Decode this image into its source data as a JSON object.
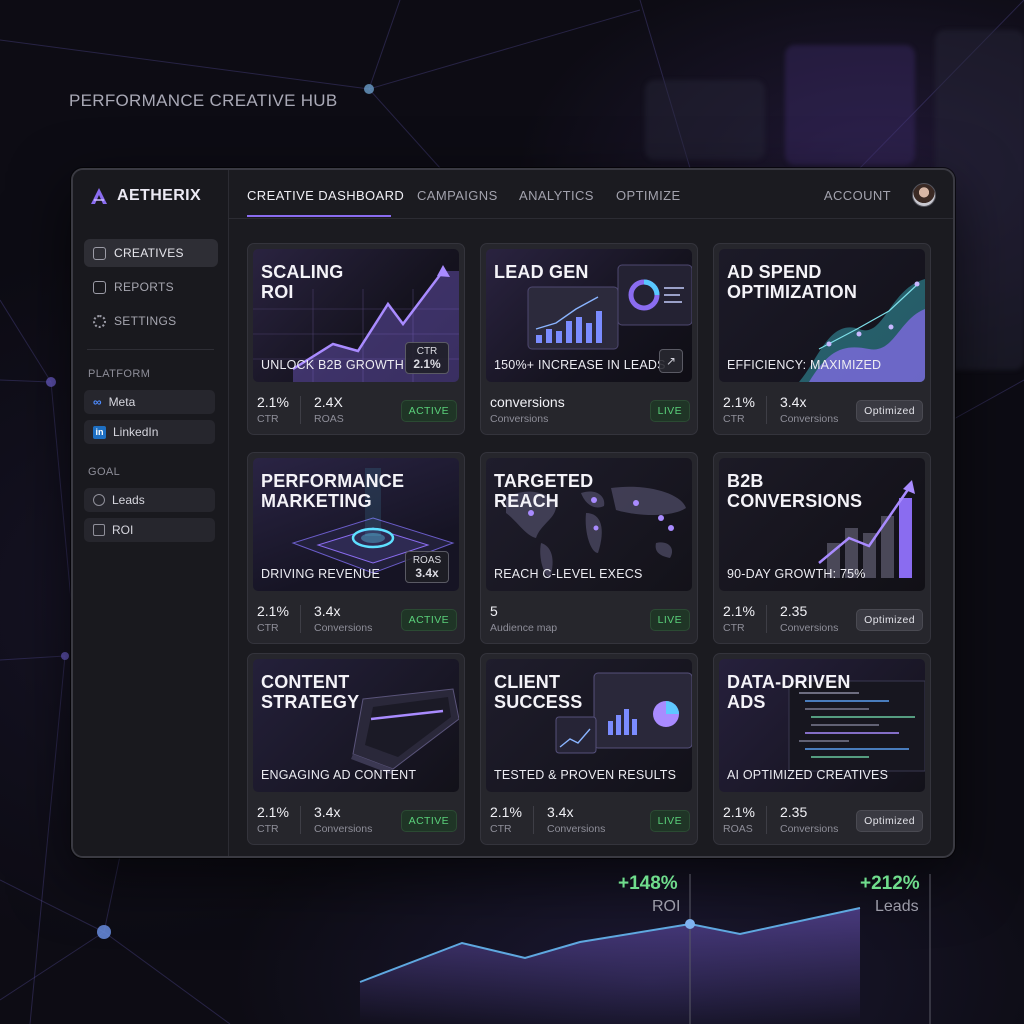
{
  "hub_title": "PERFORMANCE CREATIVE HUB",
  "brand": {
    "name": "AETHERIX",
    "logo_icon": "aetherix-logo-icon"
  },
  "sidebar": {
    "nav": [
      {
        "label": "CREATIVES",
        "icon": "image-icon",
        "active": true
      },
      {
        "label": "REPORTS",
        "icon": "report-icon",
        "active": false
      },
      {
        "label": "SETTINGS",
        "icon": "gear-icon",
        "active": false
      }
    ],
    "platform_heading": "PLATFORM",
    "platforms": [
      {
        "label": "Meta",
        "icon": "meta-icon"
      },
      {
        "label": "LinkedIn",
        "icon": "linkedin-icon"
      }
    ],
    "goal_heading": "GOAL",
    "goals": [
      {
        "label": "Leads",
        "icon": "target-icon"
      },
      {
        "label": "ROI",
        "icon": "trend-icon"
      }
    ]
  },
  "topnav": {
    "tabs": [
      "CREATIVE DASHBOARD",
      "CAMPAIGNS",
      "ANALYTICS",
      "OPTIMIZE"
    ],
    "active_tab": "CREATIVE DASHBOARD",
    "account": "ACCOUNT"
  },
  "cards": [
    {
      "title": "SCALING\nROI",
      "caption": "UNLOCK B2B GROWTH",
      "chip_label": "CTR",
      "chip_value": "2.1%",
      "m1_value": "2.1%",
      "m1_label": "CTR",
      "m2_value": "2.4X",
      "m2_label": "ROAS",
      "badge": "ACTIVE",
      "badge_style": "green",
      "visual": "roi-growth-chart"
    },
    {
      "title": "LEAD GEN",
      "caption": "150%+ INCREASE IN LEADS",
      "chip_label": "",
      "chip_value": "",
      "m1_value": "conversions",
      "m1_label": "Conversions",
      "m2_value": "",
      "m2_label": "",
      "badge": "LIVE",
      "badge_style": "green",
      "visual": "lead-dashboard"
    },
    {
      "title": "AD SPEND\nOPTIMIZATION",
      "caption": "EFFICIENCY: MAXIMIZED",
      "chip_label": "",
      "chip_value": "",
      "m1_value": "2.1%",
      "m1_label": "CTR",
      "m2_value": "3.4x",
      "m2_label": "Conversions",
      "badge": "Optimized",
      "badge_style": "grey",
      "visual": "area-waves"
    },
    {
      "title": "PERFORMANCE\nMARKETING",
      "caption": "DRIVING REVENUE",
      "chip_label": "ROAS",
      "chip_value": "3.4x",
      "m1_value": "2.1%",
      "m1_label": "CTR",
      "m2_value": "3.4x",
      "m2_label": "Conversions",
      "badge": "ACTIVE",
      "badge_style": "green",
      "visual": "glow-platform"
    },
    {
      "title": "TARGETED\nREACH",
      "caption": "REACH C-LEVEL EXECS",
      "chip_label": "",
      "chip_value": "",
      "m1_value": "5",
      "m1_label": "Audience map",
      "m2_value": "",
      "m2_label": "",
      "badge": "LIVE",
      "badge_style": "green",
      "visual": "world-map"
    },
    {
      "title": "B2B\nCONVERSIONS",
      "caption": "90-DAY GROWTH: 75%",
      "chip_label": "",
      "chip_value": "",
      "m1_value": "2.1%",
      "m1_label": "CTR",
      "m2_value": "2.35",
      "m2_label": "Conversions",
      "badge": "Optimized",
      "badge_style": "grey",
      "visual": "bar-growth"
    },
    {
      "title": "CONTENT\nSTRATEGY",
      "caption": "ENGAGING AD CONTENT",
      "chip_label": "",
      "chip_value": "",
      "m1_value": "2.1%",
      "m1_label": "CTR",
      "m2_value": "3.4x",
      "m2_label": "Conversions",
      "badge": "ACTIVE",
      "badge_style": "green",
      "visual": "device-slab"
    },
    {
      "title": "CLIENT\nSUCCESS",
      "caption": "TESTED & PROVEN RESULTS",
      "chip_label": "",
      "chip_value": "",
      "m1_value": "2.1%",
      "m1_label": "CTR",
      "m2_value": "3.4x",
      "m2_label": "Conversions",
      "badge": "LIVE",
      "badge_style": "green",
      "visual": "report-screens"
    },
    {
      "title": "DATA-DRIVEN\nADS",
      "caption": "AI OPTIMIZED CREATIVES",
      "chip_label": "",
      "chip_value": "",
      "m1_value": "2.1%",
      "m1_label": "ROAS",
      "m2_value": "2.35",
      "m2_label": "Conversions",
      "badge": "Optimized",
      "badge_style": "grey",
      "visual": "code-screen"
    }
  ],
  "bottom_chart": {
    "roi_value": "+148%",
    "roi_label": "ROI",
    "leads_value": "+212%",
    "leads_label": "Leads",
    "accent": "#8a6cf0",
    "positive": "#6fdc8c"
  }
}
